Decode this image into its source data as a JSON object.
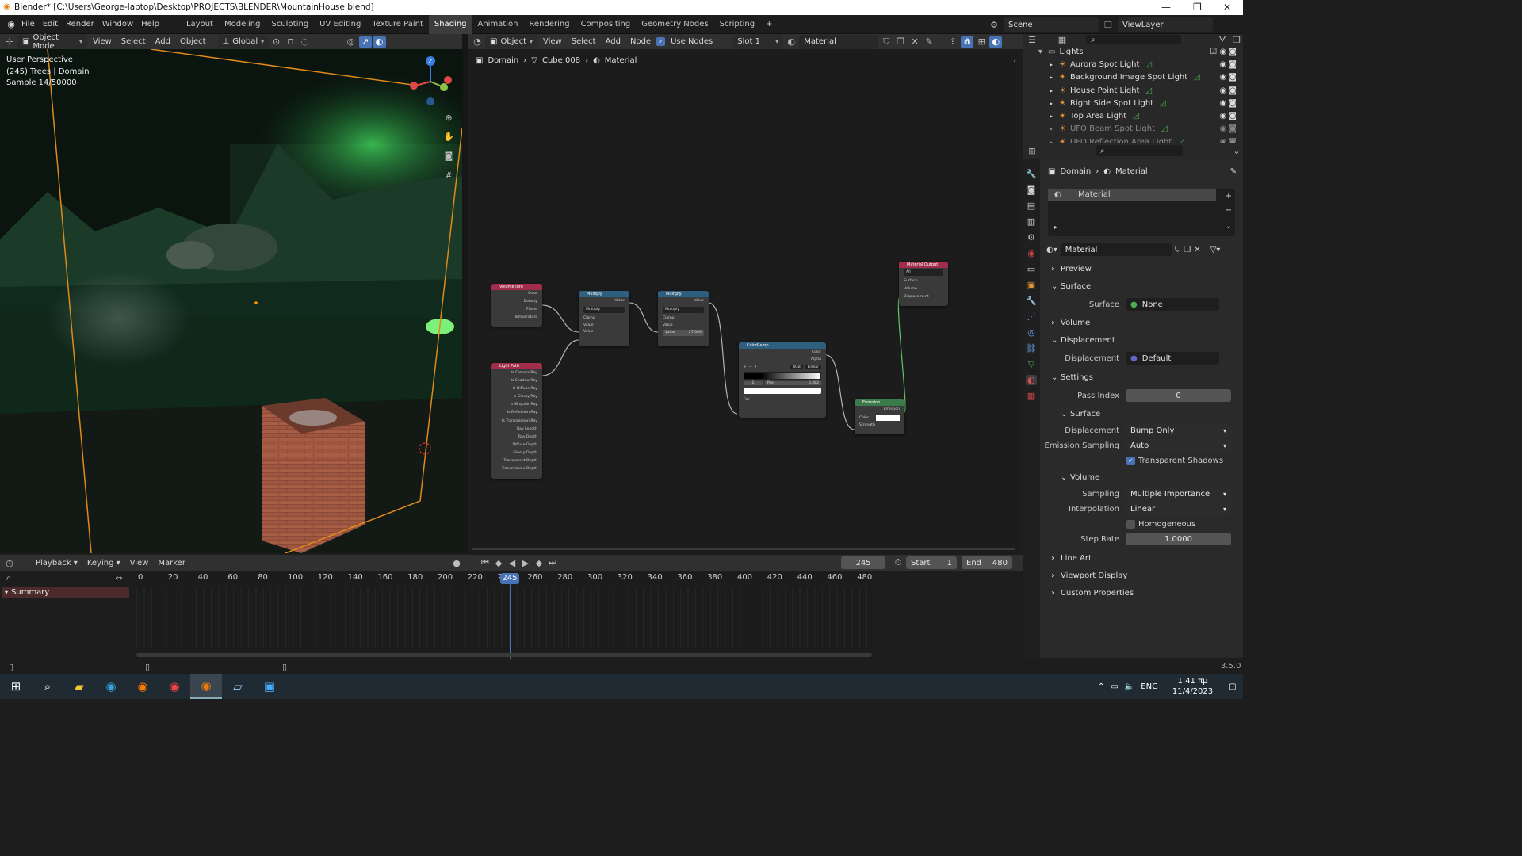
{
  "window": {
    "title": "Blender* [C:\\Users\\George-laptop\\Desktop\\PROJECTS\\BLENDER\\MountainHouse.blend]"
  },
  "menu": [
    "File",
    "Edit",
    "Render",
    "Window",
    "Help"
  ],
  "workspaces": [
    "Layout",
    "Modeling",
    "Sculpting",
    "UV Editing",
    "Texture Paint",
    "Shading",
    "Animation",
    "Rendering",
    "Compositing",
    "Geometry Nodes",
    "Scripting"
  ],
  "active_workspace": "Shading",
  "scene": {
    "label": "Scene",
    "viewlayer": "ViewLayer"
  },
  "viewport": {
    "mode": "Object Mode",
    "menus": [
      "View",
      "Select",
      "Add",
      "Object"
    ],
    "orientation": "Global",
    "overlay_lines": [
      "User Perspective",
      "(245) Trees | Domain",
      "Sample 14/50000"
    ]
  },
  "node_editor": {
    "object_type": "Object",
    "menus": [
      "View",
      "Select",
      "Add",
      "Node"
    ],
    "use_nodes_label": "Use Nodes",
    "slot": "Slot 1",
    "material": "Material",
    "breadcrumb": [
      "Domain",
      "Cube.008",
      "Material"
    ],
    "nodes": {
      "volume_info": {
        "title": "Volume Info",
        "outputs": [
          "Color",
          "Density",
          "Flame",
          "Temperature"
        ]
      },
      "light_path": {
        "title": "Light Path",
        "outputs": [
          "Is Camera Ray",
          "Is Shadow Ray",
          "Is Diffuse Ray",
          "Is Glossy Ray",
          "Is Singular Ray",
          "Is Reflection Ray",
          "Is Transmission Ray",
          "Ray Length",
          "Ray Depth",
          "Diffuse Depth",
          "Glossy Depth",
          "Transparent Depth",
          "Transmission Depth"
        ]
      },
      "multiply1": {
        "title": "Multiply",
        "out": "Value",
        "op": "Multiply",
        "clamp": "Clamp",
        "in1": "Value",
        "in2": "Value"
      },
      "multiply2": {
        "title": "Multiply",
        "out": "Value",
        "op": "Multiply",
        "clamp": "Clamp",
        "in1": "Value",
        "in2": "Value",
        "in2_val": "27.000"
      },
      "color_ramp": {
        "title": "ColorRamp",
        "outputs": [
          "Color",
          "Alpha"
        ],
        "mode": "RGB",
        "interp": "Linear",
        "idx": "1",
        "pos_label": "Pos",
        "pos": "0.282",
        "in": "Fac"
      },
      "emission": {
        "title": "Emission",
        "out": "Emission",
        "in1": "Color",
        "in2": "Strength"
      },
      "material_output": {
        "title": "Material Output",
        "target": "All",
        "inputs": [
          "Surface",
          "Volume",
          "Displacement"
        ]
      }
    }
  },
  "outliner": {
    "collection": "Lights",
    "items": [
      "Aurora Spot Light",
      "Background Image Spot Light",
      "House Point Light",
      "Right Side Spot Light",
      "Top Area Light",
      "UFO Beam Spot Light",
      "UFO Reflection Area Light"
    ]
  },
  "properties": {
    "breadcrumb": [
      "Domain",
      "Material"
    ],
    "slot_name": "Material",
    "material_name": "Material",
    "panels": {
      "preview": "Preview",
      "surface": "Surface",
      "surface_label": "Surface",
      "surface_value": "None",
      "volume": "Volume",
      "displacement": "Displacement",
      "displacement_label": "Displacement",
      "displacement_value": "Default",
      "settings": "Settings",
      "pass_index_label": "Pass Index",
      "pass_index": "0",
      "sub_surface": "Surface",
      "disp_method_label": "Displacement",
      "disp_method": "Bump Only",
      "emission_sampling_label": "Emission Sampling",
      "emission_sampling": "Auto",
      "transparent_shadows": "Transparent Shadows",
      "sub_volume": "Volume",
      "sampling_label": "Sampling",
      "sampling": "Multiple Importance",
      "interpolation_label": "Interpolation",
      "interpolation": "Linear",
      "homogeneous": "Homogeneous",
      "step_rate_label": "Step Rate",
      "step_rate": "1.0000",
      "line_art": "Line Art",
      "viewport_display": "Viewport Display",
      "custom_properties": "Custom Properties"
    }
  },
  "timeline": {
    "menus": [
      "Playback",
      "Keying",
      "View",
      "Marker"
    ],
    "current_frame": "245",
    "start_label": "Start",
    "start": "1",
    "end_label": "End",
    "end": "480",
    "summary": "Summary",
    "ticks": [
      "0",
      "20",
      "40",
      "60",
      "80",
      "100",
      "120",
      "140",
      "160",
      "180",
      "200",
      "220",
      "2",
      "260",
      "280",
      "300",
      "320",
      "340",
      "360",
      "380",
      "400",
      "420",
      "440",
      "460",
      "480"
    ],
    "playhead_label": "245"
  },
  "status": {
    "version": "3.5.0"
  },
  "taskbar": {
    "lang": "ENG",
    "time": "1:41 πμ",
    "date": "11/4/2023"
  },
  "colors": {
    "accent": "#4772b3",
    "node_output": "#c7c729",
    "node_float": "#a1a1a1",
    "wire": "#b3b3b3",
    "green_wire": "#63c763"
  }
}
